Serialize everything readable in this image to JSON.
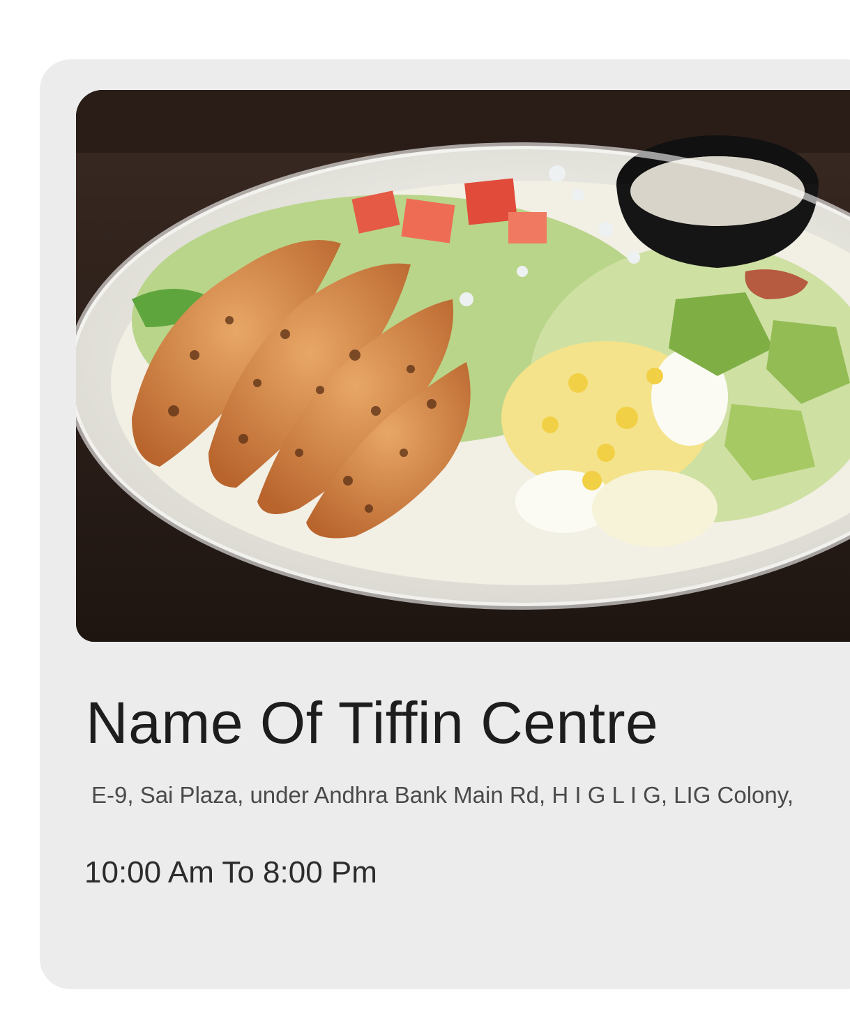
{
  "card": {
    "image_alt": "Salad bowl with grilled chicken, egg, avocado, lettuce, tomato and dressing",
    "title": "Name Of Tiffin Centre",
    "address": "E-9, Sai Plaza, under Andhra Bank Main Rd, H I G L I G, LIG Colony,",
    "hours": "10:00 Am To 8:00 Pm"
  },
  "colors": {
    "card_background": "#ececec",
    "page_background": "#ffffff",
    "title_text": "#1d1d1d",
    "address_text": "#4a4a4a"
  }
}
